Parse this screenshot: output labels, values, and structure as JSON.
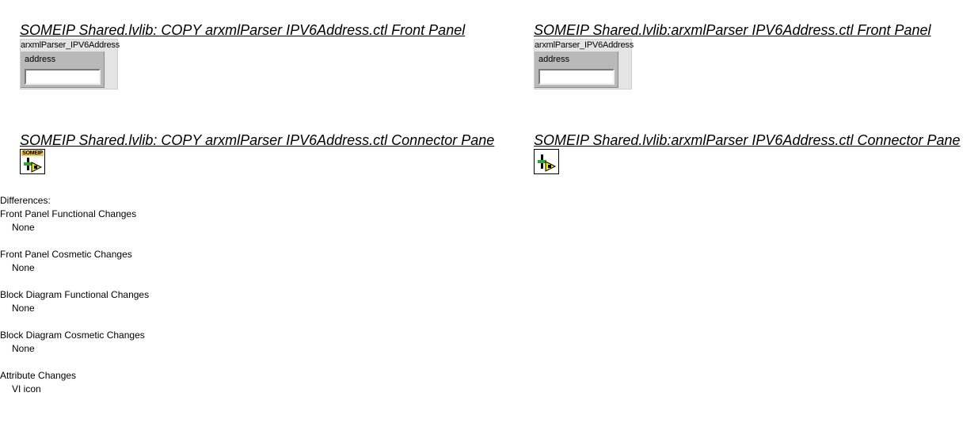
{
  "left": {
    "front_panel_title": "SOMEIP Shared.lvlib:  COPY  arxmlParser  IPV6Address.ctl Front Panel",
    "cluster_caption": "arxmlParser_IPV6Address",
    "control_label": "address",
    "control_value": "",
    "connector_pane_title": "SOMEIP Shared.lvlib:  COPY  arxmlParser  IPV6Address.ctl Connector Pane",
    "icon_tag": "SOMEIP"
  },
  "right": {
    "front_panel_title": "SOMEIP Shared.lvlib:arxmlParser  IPV6Address.ctl Front Panel",
    "cluster_caption": "arxmlParser_IPV6Address",
    "control_label": "address",
    "control_value": "",
    "connector_pane_title": "SOMEIP Shared.lvlib:arxmlParser  IPV6Address.ctl Connector Pane"
  },
  "differences": {
    "heading": "Differences:",
    "front_panel_functional": {
      "label": "Front Panel Functional Changes",
      "value": "None"
    },
    "front_panel_cosmetic": {
      "label": "Front Panel Cosmetic Changes",
      "value": "None"
    },
    "block_diagram_functional": {
      "label": "Block Diagram Functional Changes",
      "value": "None"
    },
    "block_diagram_cosmetic": {
      "label": "Block Diagram Cosmetic Changes",
      "value": "None"
    },
    "attribute": {
      "label": "Attribute Changes",
      "value": "VI icon"
    }
  },
  "colors": {
    "cluster_bg": "#e4e4e4",
    "control_bg": "#b9b9b9",
    "icon_tag": "#f3c23c",
    "icon_arrow": "#f2e600"
  }
}
